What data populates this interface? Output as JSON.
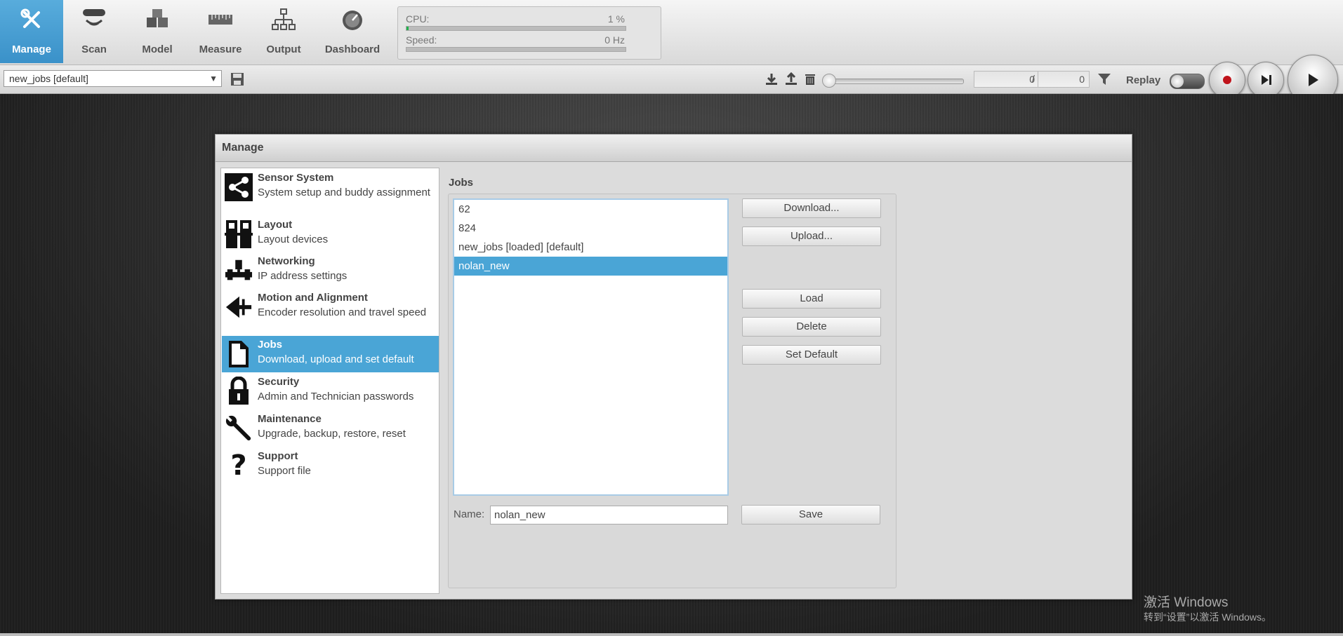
{
  "nav": {
    "items": [
      {
        "label": "Manage",
        "icon": "manage-tools-icon",
        "active": true
      },
      {
        "label": "Scan",
        "icon": "scan-icon"
      },
      {
        "label": "Model",
        "icon": "model-cubes-icon"
      },
      {
        "label": "Measure",
        "icon": "measure-ruler-icon"
      },
      {
        "label": "Output",
        "icon": "output-network-icon"
      },
      {
        "label": "Dashboard",
        "icon": "dashboard-gauge-icon"
      }
    ]
  },
  "status": {
    "cpu_label": "CPU:",
    "cpu_value": "1 %",
    "cpu_fraction": 0.01,
    "speed_label": "Speed:",
    "speed_value": "0 Hz",
    "speed_fraction": 0
  },
  "toolbar": {
    "job_selected": "new_jobs [default]",
    "frame_current": "0",
    "frame_separator": "/",
    "frame_total": "0",
    "replay_label": "Replay"
  },
  "window": {
    "title": "Manage",
    "sidebar": [
      {
        "title": "Sensor System",
        "desc": "System setup and buddy assignment",
        "icon": "sensor-system-share-icon"
      },
      {
        "title": "Layout",
        "desc": "Layout devices",
        "icon": "layout-grid-icon"
      },
      {
        "title": "Networking",
        "desc": "IP address settings",
        "icon": "networking-icon"
      },
      {
        "title": "Motion and Alignment",
        "desc": "Encoder resolution and travel speed",
        "icon": "motion-alignment-icon"
      },
      {
        "title": "Jobs",
        "desc": "Download, upload and set default",
        "icon": "jobs-document-icon",
        "active": true
      },
      {
        "title": "Security",
        "desc": "Admin and Technician passwords",
        "icon": "security-lock-icon"
      },
      {
        "title": "Maintenance",
        "desc": "Upgrade, backup, restore, reset",
        "icon": "maintenance-wrench-icon"
      },
      {
        "title": "Support",
        "desc": "Support file",
        "icon": "support-question-icon"
      }
    ],
    "jobs": {
      "heading": "Jobs",
      "list": [
        "62",
        "824",
        "new_jobs [loaded] [default]",
        "nolan_new"
      ],
      "selected_index": 3,
      "buttons": {
        "download": "Download...",
        "upload": "Upload...",
        "load": "Load",
        "delete": "Delete",
        "set_default": "Set Default",
        "save": "Save"
      },
      "name_label": "Name:",
      "name_value": "nolan_new"
    }
  },
  "watermark": {
    "title": "激活 Windows",
    "subtitle": "转到“设置”以激活 Windows。"
  },
  "colors": {
    "accent": "#4aa5d6",
    "nav_active": "#3a91c9",
    "cpu_bar": "#22b14c",
    "record_dot": "#c0141c"
  }
}
